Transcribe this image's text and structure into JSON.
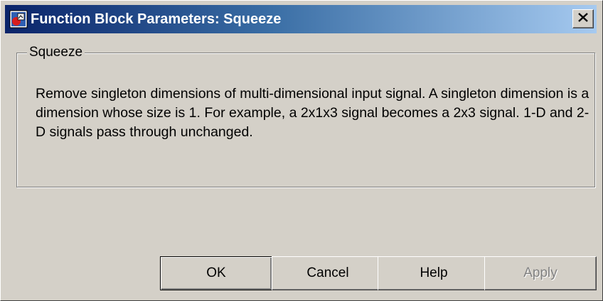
{
  "window": {
    "title": "Function Block Parameters: Squeeze",
    "close_label": "×"
  },
  "group": {
    "legend": "Squeeze",
    "description": "Remove singleton dimensions of multi-dimensional input signal. A singleton dimension is a dimension whose size is 1. For example, a 2x1x3 signal becomes a 2x3 signal. 1-D and 2-D signals pass through unchanged."
  },
  "buttons": {
    "ok": "OK",
    "cancel": "Cancel",
    "help": "Help",
    "apply": "Apply",
    "apply_enabled": false
  },
  "colors": {
    "title_gradient_start": "#0a246a",
    "title_gradient_end": "#a6caf0",
    "face": "#d4d0c8",
    "disabled_text": "#808080"
  },
  "icons": {
    "title_icon": "simulink-block-icon",
    "close_icon": "close-icon"
  }
}
